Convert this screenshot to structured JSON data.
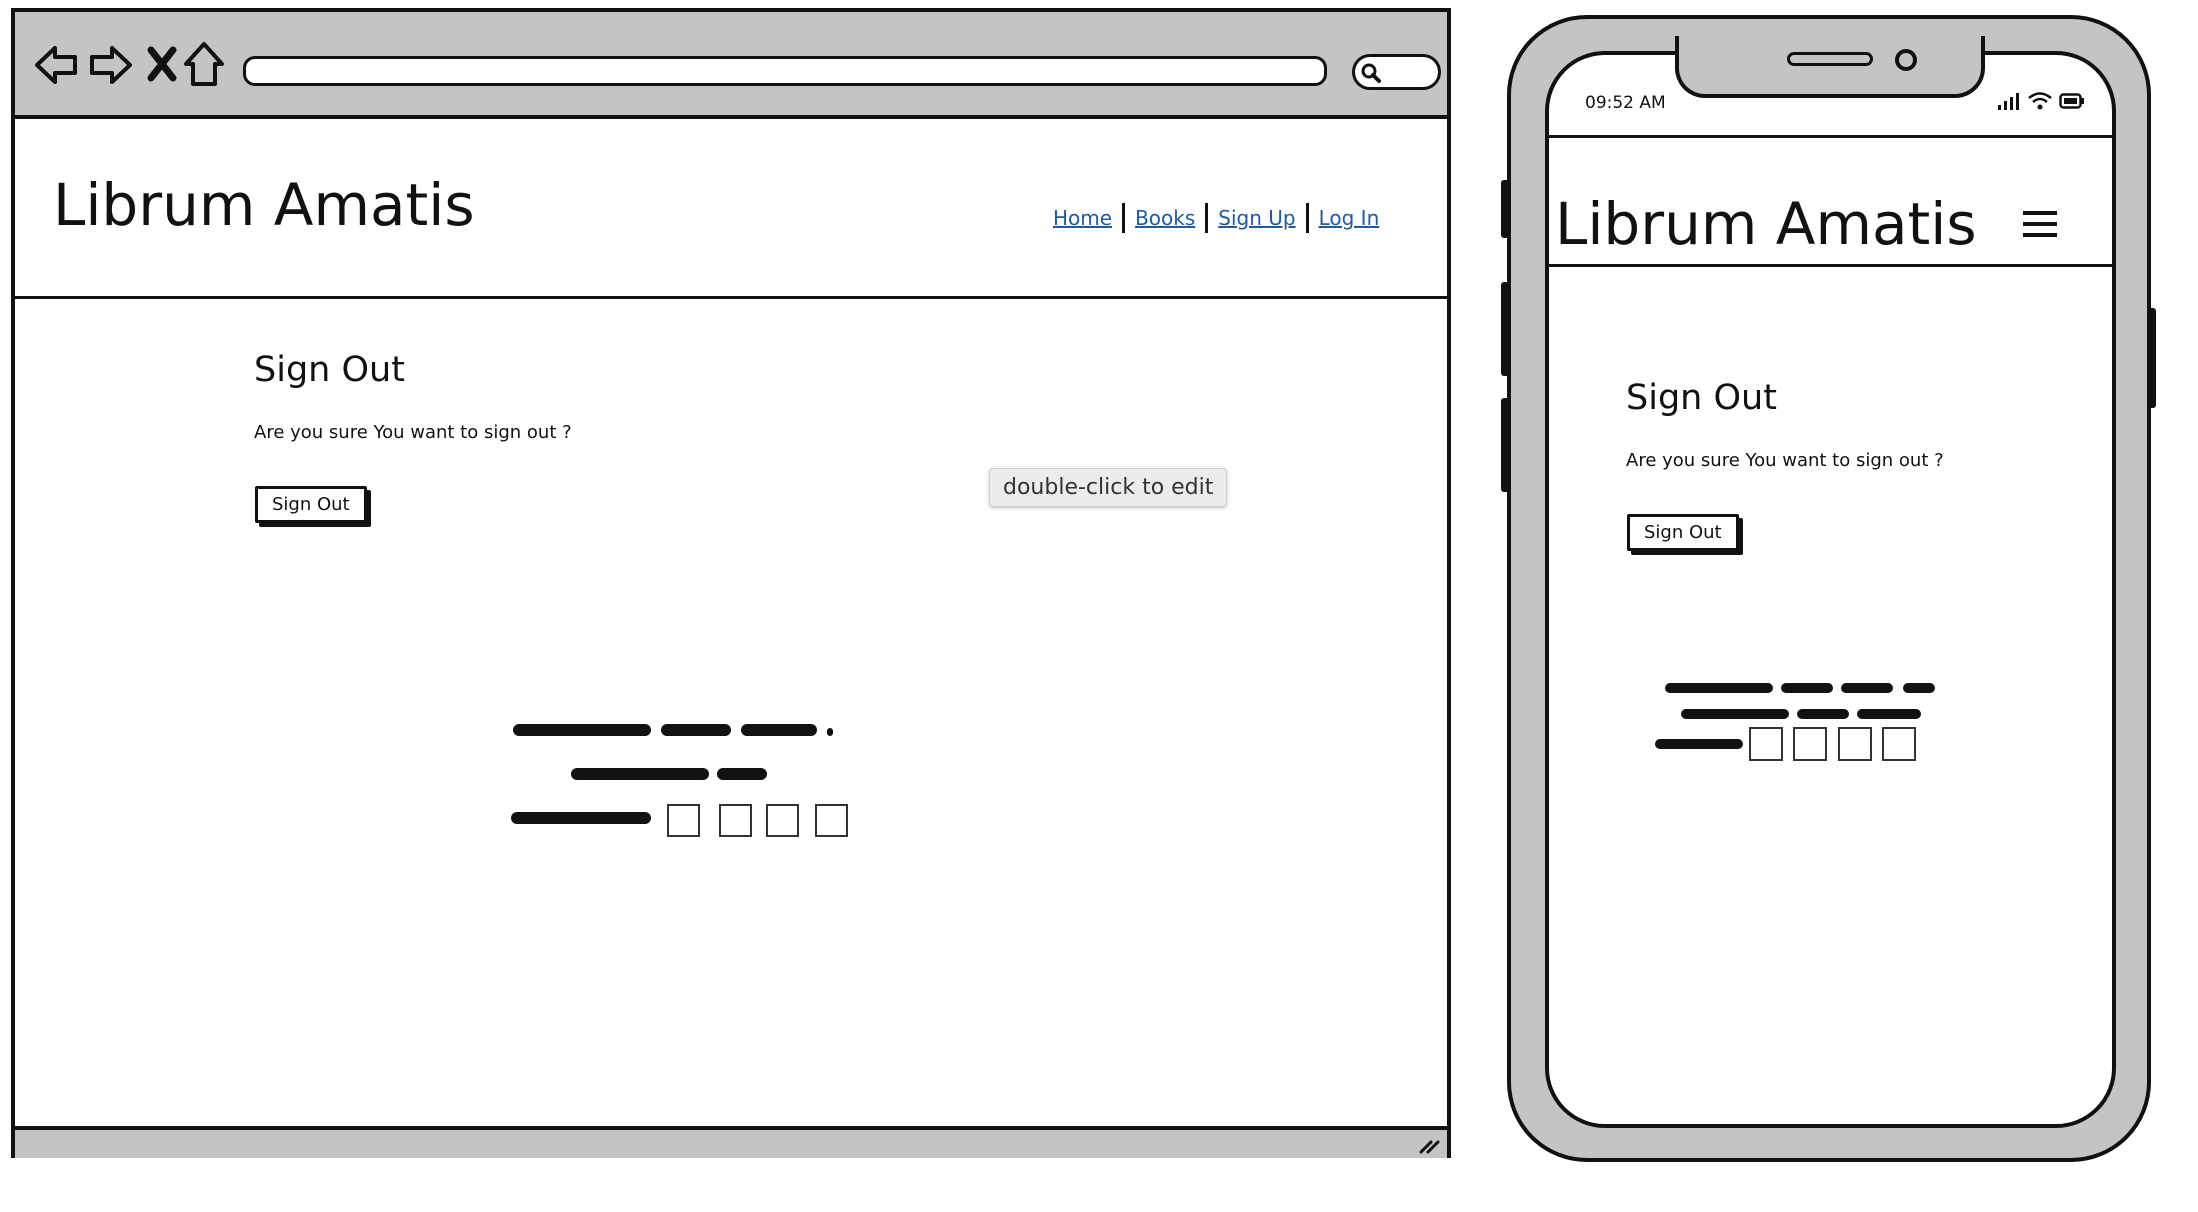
{
  "app": {
    "brand": "Librum Amatis"
  },
  "desktop": {
    "nav": {
      "home": "Home",
      "books": "Books",
      "signup": "Sign Up",
      "login": "Log In"
    },
    "page": {
      "heading": "Sign Out",
      "prompt": "Are you sure You want to sign out ?",
      "button": "Sign Out"
    },
    "tooltip": "double-click to edit"
  },
  "mobile": {
    "status_time": "09:52 AM",
    "page": {
      "heading": "Sign Out",
      "prompt": "Are you sure You want to sign out ?",
      "button": "Sign Out"
    }
  },
  "icons": {
    "back": "back-arrow-icon",
    "forward": "forward-arrow-icon",
    "stop": "close-icon",
    "home": "home-icon",
    "search": "search-icon",
    "resize": "resize-grip-icon",
    "menu": "hamburger-menu-icon",
    "signal": "signal-icon",
    "wifi": "wifi-icon",
    "battery": "battery-icon"
  },
  "colors": {
    "link": "#1f5aa6",
    "chrome_gray": "#c4c4c4",
    "ink": "#111111"
  }
}
